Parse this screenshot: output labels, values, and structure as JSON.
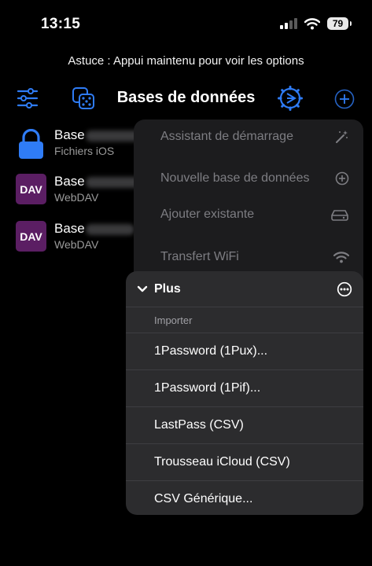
{
  "status_bar": {
    "time": "13:15",
    "battery": "79"
  },
  "hint": "Astuce : Appui maintenu pour voir les options",
  "toolbar": {
    "title": "Bases de données"
  },
  "databases": [
    {
      "name": "Base",
      "location": "Fichiers iOS",
      "icon": "lock-icon"
    },
    {
      "name": "Base",
      "location": "WebDAV",
      "badge": "DAV"
    },
    {
      "name": "Base",
      "location": "WebDAV",
      "badge": "DAV"
    }
  ],
  "menu": {
    "items": [
      {
        "label": "Assistant de démarrage",
        "icon": "magic-wand-icon"
      },
      {
        "label": "Nouvelle base de données",
        "icon": "plus-circle-icon"
      },
      {
        "label": "Ajouter existante",
        "icon": "drive-icon"
      },
      {
        "label": "Transfert WiFi",
        "icon": "wifi-icon"
      }
    ],
    "submenu": {
      "title": "Plus",
      "section": "Importer",
      "items": [
        "1Password (1Pux)...",
        "1Password (1Pif)...",
        "LastPass (CSV)",
        "Trousseau iCloud (CSV)",
        "CSV Générique..."
      ]
    }
  },
  "colors": {
    "accent": "#2f7cf6",
    "dav_badge": "#5b1e63"
  }
}
